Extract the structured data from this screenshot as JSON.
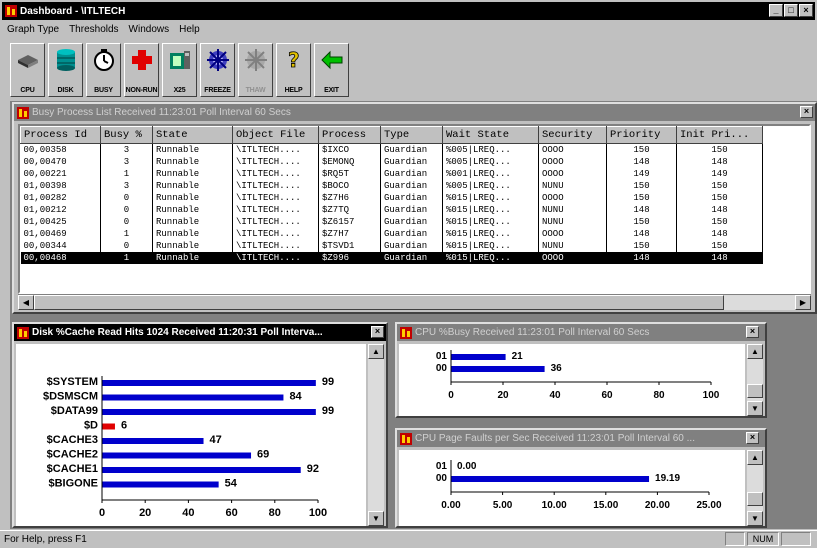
{
  "app": {
    "title": "Dashboard - \\ITLTECH",
    "win_buttons": [
      "_",
      "□",
      "×"
    ]
  },
  "menu": [
    "Graph Type",
    "Thresholds",
    "Windows",
    "Help"
  ],
  "toolbar": [
    {
      "label": "CPU",
      "icon": "cpu-icon"
    },
    {
      "label": "DISK",
      "icon": "disk-icon"
    },
    {
      "label": "BUSY",
      "icon": "busy-icon"
    },
    {
      "label": "NON-RUN",
      "icon": "non-run-icon"
    },
    {
      "label": "X25",
      "icon": "x25-icon"
    },
    {
      "label": "FREEZE",
      "icon": "freeze-icon"
    },
    {
      "label": "THAW",
      "icon": "thaw-icon",
      "disabled": true
    },
    {
      "label": "HELP",
      "icon": "help-icon"
    },
    {
      "label": "EXIT",
      "icon": "exit-icon"
    }
  ],
  "process_window": {
    "title": "Busy Process List Received 11:23:01  Poll Interval 60  Secs",
    "columns": [
      "Process Id",
      "Busy %",
      "State",
      "Object File",
      "Process",
      "Type",
      "Wait State",
      "Security",
      "Priority",
      "Init Pri..."
    ],
    "rows": [
      [
        "00,00358",
        "3",
        "Runnable",
        "\\ITLTECH....",
        "$IXCO",
        "Guardian",
        "%005|LREQ...",
        "OOOO",
        "150",
        "150"
      ],
      [
        "00,00470",
        "3",
        "Runnable",
        "\\ITLTECH....",
        "$EMONQ",
        "Guardian",
        "%005|LREQ...",
        "OOOO",
        "148",
        "148"
      ],
      [
        "00,00221",
        "1",
        "Runnable",
        "\\ITLTECH....",
        "$RQ5T",
        "Guardian",
        "%001|LREQ...",
        "OOOO",
        "149",
        "149"
      ],
      [
        "01,00398",
        "3",
        "Runnable",
        "\\ITLTECH....",
        "$BOCO",
        "Guardian",
        "%005|LREQ...",
        "NUNU",
        "150",
        "150"
      ],
      [
        "01,00282",
        "0",
        "Runnable",
        "\\ITLTECH....",
        "$Z7H6",
        "Guardian",
        "%015|LREQ...",
        "OOOO",
        "150",
        "150"
      ],
      [
        "01,00212",
        "0",
        "Runnable",
        "\\ITLTECH....",
        "$Z7TQ",
        "Guardian",
        "%015|LREQ...",
        "NUNU",
        "148",
        "148"
      ],
      [
        "01,00425",
        "0",
        "Runnable",
        "\\ITLTECH....",
        "$Z6157",
        "Guardian",
        "%015|LREQ...",
        "NUNU",
        "150",
        "150"
      ],
      [
        "01,00469",
        "1",
        "Runnable",
        "\\ITLTECH....",
        "$Z7H7",
        "Guardian",
        "%015|LREQ...",
        "OOOO",
        "148",
        "148"
      ],
      [
        "00,00344",
        "0",
        "Runnable",
        "\\ITLTECH....",
        "$TSVD1",
        "Guardian",
        "%015|LREQ...",
        "NUNU",
        "150",
        "150"
      ],
      [
        "00,00468",
        "1",
        "Runnable",
        "\\ITLTECH....",
        "$Z996",
        "Guardian",
        "%015|LREQ...",
        "OOOO",
        "148",
        "148"
      ]
    ],
    "selected_row": 9
  },
  "disk_window": {
    "title": "Disk %Cache Read Hits 1024  Received 11:20:31  Poll Interva..."
  },
  "cpu_busy_window": {
    "title": "CPU %Busy  Received 11:23:01  Poll Interval  60  Secs"
  },
  "cpu_faults_window": {
    "title": "CPU Page Faults per Sec  Received 11:23:01  Poll Interval  60 ..."
  },
  "status": {
    "help_text": "For Help, press F1",
    "num": "NUM"
  },
  "colors": {
    "bar": "#0000cc",
    "bar_alert": "#e00000"
  },
  "chart_data": [
    {
      "type": "bar",
      "orientation": "horizontal",
      "categories": [
        "$SYSTEM",
        "$DSMSCM",
        "$DATA99",
        "$D",
        "$CACHE3",
        "$CACHE2",
        "$CACHE1",
        "$BIGONE"
      ],
      "values": [
        99,
        84,
        99,
        6,
        47,
        69,
        92,
        54
      ],
      "xlim": [
        0,
        100
      ],
      "xticks": [
        "0",
        "20",
        "40",
        "60",
        "80",
        "100"
      ]
    },
    {
      "type": "bar",
      "orientation": "horizontal",
      "categories": [
        "01",
        "00"
      ],
      "values": [
        21,
        36
      ],
      "xlim": [
        0,
        100
      ],
      "xticks": [
        "0",
        "20",
        "40",
        "60",
        "80",
        "100"
      ]
    },
    {
      "type": "bar",
      "orientation": "horizontal",
      "categories": [
        "01",
        "00"
      ],
      "values": [
        0.0,
        19.19
      ],
      "value_labels": [
        "0.00",
        "19.19"
      ],
      "xlim": [
        0,
        25
      ],
      "xticks": [
        "0.00",
        "5.00",
        "10.00",
        "15.00",
        "20.00",
        "25.00"
      ]
    }
  ]
}
